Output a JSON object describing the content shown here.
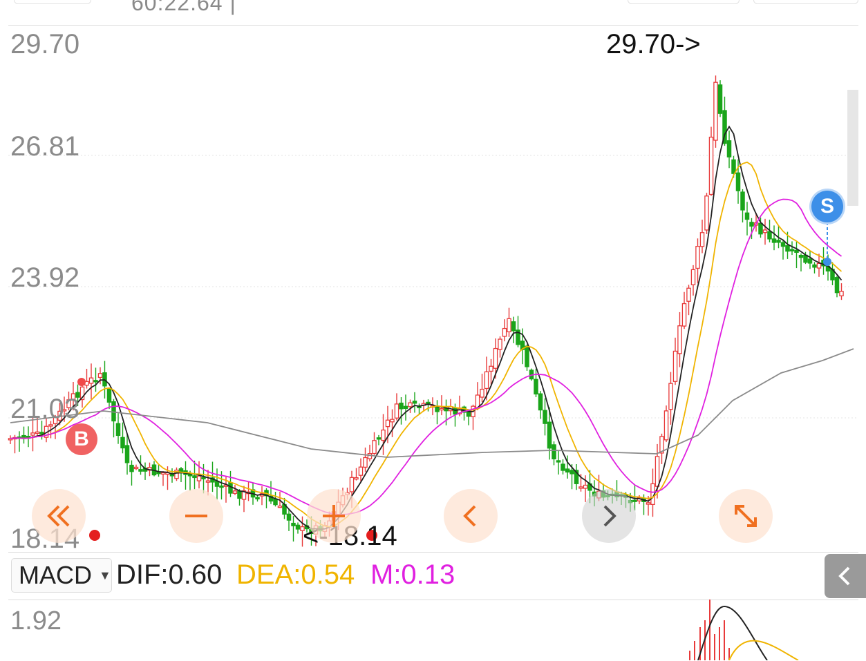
{
  "header": {
    "value_text": "60:22.64 |"
  },
  "price_axis": {
    "labels": [
      "29.70",
      "26.81",
      "23.92",
      "21.03",
      "18.14"
    ]
  },
  "annotations": {
    "high_marker": "29.70->",
    "low_marker": "<-18.14",
    "buy_badge": "B",
    "sell_badge": "S"
  },
  "controls": {
    "first": "«",
    "zoom_out": "−",
    "prev": "‹",
    "next": "›",
    "expand": "⤡"
  },
  "indicator": {
    "selected": "MACD",
    "dif": "DIF:0.60",
    "dea": "DEA:0.54",
    "m": "M:0.13",
    "colors": {
      "dif": "#222222",
      "dea": "#f0b400",
      "m": "#e020e0"
    }
  },
  "macd_axis": {
    "top_label": "1.92"
  },
  "colors": {
    "up": "#e83a3a",
    "down": "#1aa51a",
    "ma_black": "#222222",
    "ma_yellow": "#f0b400",
    "ma_magenta": "#e020e0",
    "ma_gray": "#8a8a8a",
    "accent_orange": "#f07020"
  }
}
